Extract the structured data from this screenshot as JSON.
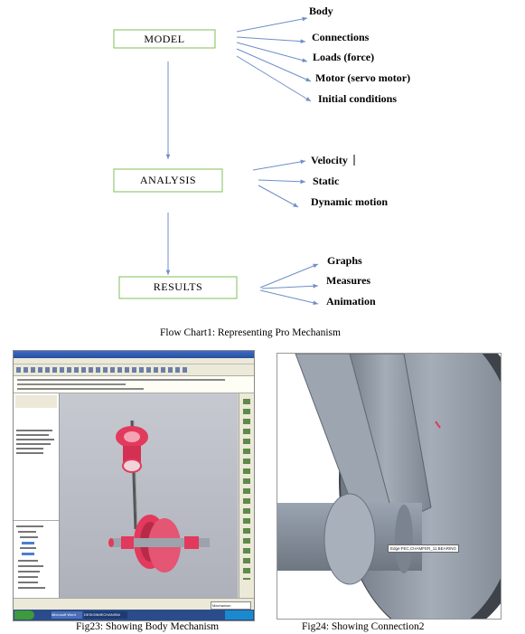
{
  "flowchart": {
    "model": {
      "label": "MODEL",
      "items": [
        "Body",
        "Connections",
        "Loads (force)",
        "Motor (servo motor)",
        "Initial conditions"
      ]
    },
    "analysis": {
      "label": "ANALYSIS",
      "items": [
        "Velocity",
        "Static",
        "Dynamic motion"
      ]
    },
    "results": {
      "label": "RESULTS",
      "items": [
        "Graphs",
        "Measures",
        "Animation"
      ]
    },
    "caption": "Flow Chart1: Representing Pro Mechanism",
    "colors": {
      "arrow": "#6f8fc8",
      "box_border": "#7fbf5a"
    }
  },
  "fig23": {
    "caption": "Fig23: Showing Body Mechanism",
    "taskbar_items": [
      "Microsoft Word",
      "DESIGNMECHANISM"
    ],
    "status_value": "Mechanism",
    "colors": {
      "part": "#e23a5c",
      "model_bg": "#b9bcc5",
      "taskbar": "#2b4c8a"
    }
  },
  "fig24": {
    "caption": "Fig24: Showing Connection2",
    "tooltip": "Edge:FEC,CHAMFER_11,BEARING",
    "colors": {
      "part": "#8d97a3",
      "bg": "#ffffff"
    }
  }
}
